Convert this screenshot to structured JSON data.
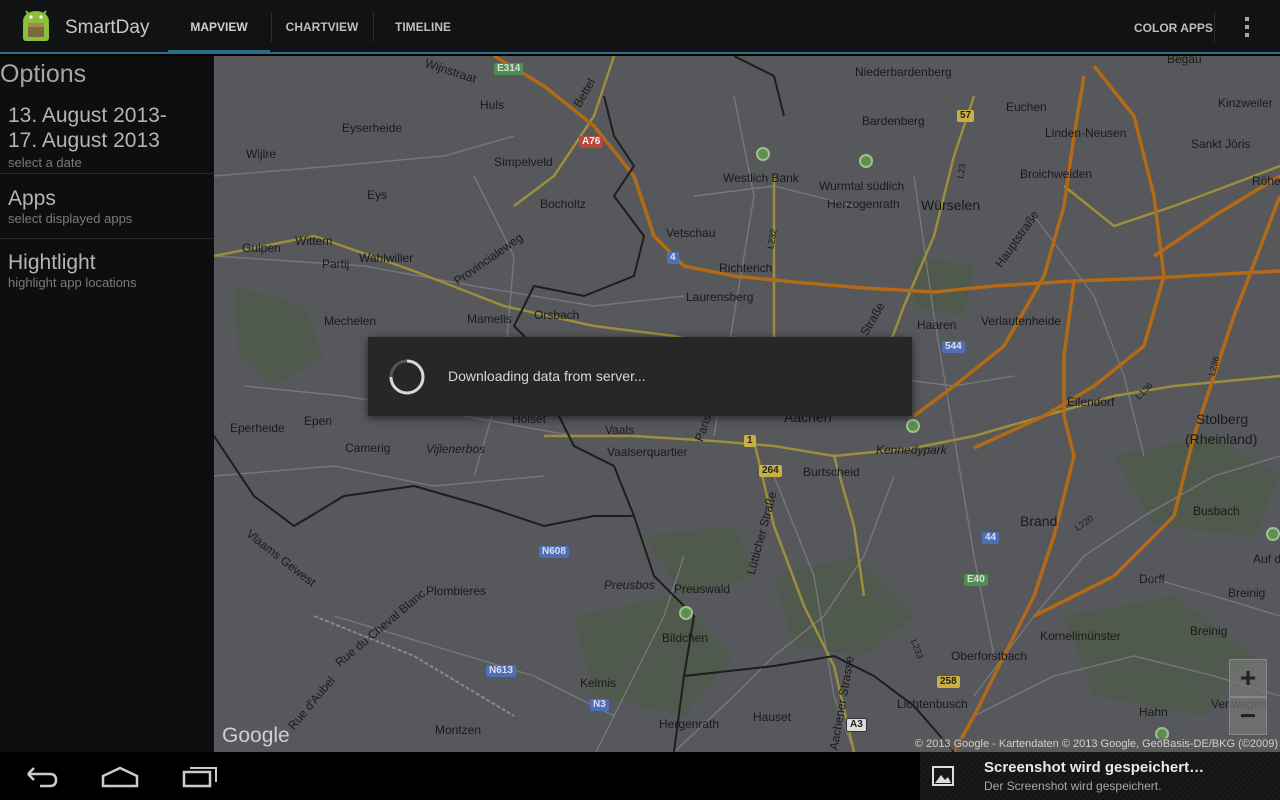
{
  "app": {
    "title": "SmartDay"
  },
  "tabs": [
    {
      "label": "MAPVIEW",
      "active": true
    },
    {
      "label": "CHARTVIEW",
      "active": false
    },
    {
      "label": "TIMELINE",
      "active": false
    }
  ],
  "actions": {
    "color_apps": "COLOR APPS",
    "overflow_icon": "overflow-menu-icon"
  },
  "sidebar": {
    "title": "Options",
    "items": [
      {
        "title_line1": "13. August 2013-",
        "title_line2": "17. August 2013",
        "subtitle": "select a date"
      },
      {
        "title": "Apps",
        "subtitle": "select displayed apps"
      },
      {
        "title": "Hightlight",
        "subtitle": "highlight app locations"
      }
    ]
  },
  "map": {
    "labels": {
      "wijnstraat": "Wijnstraat",
      "huls": "Huls",
      "eyserheide": "Eyserheide",
      "wijlre": "Wijlre",
      "simpelveld": "Simpelveld",
      "eys": "Eys",
      "bocholtz": "Bocholtz",
      "gulpen": "Gulpen",
      "wittem": "Wittem",
      "partij": "Partij",
      "wahlwiller": "Wahlwiller",
      "provincialeweg": "Provincialeweg",
      "mechelen": "Mechelen",
      "mamelis": "Mamelis",
      "orsbach": "Orsbach",
      "vetschau": "Vetschau",
      "richterich": "Richterich",
      "laurensberg": "Laurensberg",
      "niederbardenberg": "Niederbardenberg",
      "bardenberg": "Bardenberg",
      "euchen": "Euchen",
      "begau": "Begau",
      "kinzweiler": "Kinzweiler",
      "linden_neusen": "Linden-Neusen",
      "sankt_joris": "Sankt Jöris",
      "westlich_bank": "Westlich Bank",
      "wurmtal": "Wurmtal südlich",
      "herzogenrath": "Herzogenrath",
      "wurselen": "Würselen",
      "broichweiden": "Broichweiden",
      "rohe": "Röhe",
      "haaren": "Haaren",
      "verlautenheide": "Verlautenheide",
      "eilendorf": "Eilendorf",
      "stolberg": "Stolberg",
      "rheinland": "(Rheinland)",
      "epen": "Epen",
      "eperheide": "Eperheide",
      "camerig": "Camerig",
      "vijlenerbos": "Vijlenerbos",
      "holset": "Holset",
      "vaals": "Vaals",
      "vaalserquartier": "Vaalserquartier",
      "aachen": "Aachen",
      "burtscheid": "Burtscheid",
      "kennedypark": "Kennedypark",
      "brand": "Brand",
      "busbach": "Busbach",
      "auf_der": "Auf de",
      "preusbos": "Preusbos",
      "preuswald": "Preuswald",
      "bildchen": "Bildchen",
      "plombieres": "Plombieres",
      "dorff": "Dorff",
      "kornelimunster": "Kornelimünster",
      "breinig": "Breinig",
      "oberforstbach": "Oberforstbach",
      "kelmis": "Kelmis",
      "hergenrath": "Hergenrath",
      "hauset": "Hauset",
      "lichtenbusch": "Lichtenbusch",
      "montzen": "Montzen",
      "hahn": "Hahn",
      "venwegen": "Venwegen",
      "vlaams": "Vlaams Gewest",
      "cheval": "Rue du Cheval Blanc",
      "aubel": "Rue d'Aubel",
      "lutticher": "Lütticher Straße",
      "aachener": "Aachener Strasse",
      "hauptstrasse": "Hauptstraße",
      "roermonder": "er Straße",
      "paris": "Pariser",
      "bettel": "Bettel"
    },
    "shields": {
      "e314": "E314",
      "a76": "A76",
      "n57": "57",
      "n4": "4",
      "n544": "544",
      "n1": "1",
      "n264": "264",
      "n44": "44",
      "e40": "E40",
      "n608": "N608",
      "n613": "N613",
      "n3": "N3",
      "a3": "A3",
      "n258": "258",
      "l23": "L23",
      "l232": "L232",
      "l236": "L236",
      "l136": "L136",
      "l220": "L220",
      "l233": "L233"
    },
    "google_logo": "Google",
    "copyright": "© 2013 Google - Kartendaten © 2013 Google, GeoBasis-DE/BKG (©2009)",
    "zoom_in": "+",
    "zoom_out": "−"
  },
  "dialog": {
    "message": "Downloading data from server..."
  },
  "notification": {
    "title": "Screenshot wird gespeichert…",
    "subtitle": "Der Screenshot wird gespeichert."
  },
  "navbar": {
    "back_icon": "back-icon",
    "home_icon": "home-icon",
    "recents_icon": "recent-apps-icon"
  }
}
